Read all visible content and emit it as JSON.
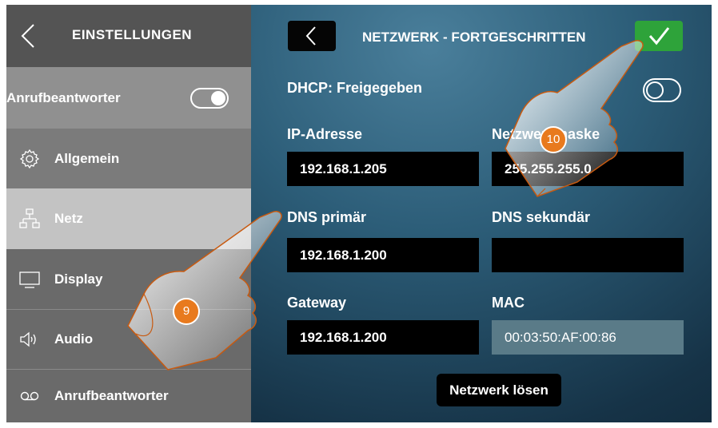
{
  "sidebar": {
    "title": "EINSTELLUNGEN",
    "answering_toggle_label": "Anrufbeantworter",
    "items": [
      {
        "label": "Allgemein",
        "icon": "gear-icon"
      },
      {
        "label": "Netz",
        "icon": "network-icon"
      },
      {
        "label": "Display",
        "icon": "monitor-icon"
      },
      {
        "label": "Audio",
        "icon": "speaker-icon"
      },
      {
        "label": "Anrufbeantworter",
        "icon": "voicemail-icon"
      }
    ]
  },
  "main": {
    "title": "NETZWERK - FORTGESCHRITTEN",
    "dhcp_label": "DHCP: Freigegeben",
    "dhcp_enabled": false,
    "fields": {
      "ip_label": "IP-Adresse",
      "ip_value": "192.168.1.205",
      "mask_label": "Netzwerkmaske",
      "mask_value": "255.255.255.0",
      "dns1_label": "DNS primär",
      "dns1_value": "192.168.1.200",
      "dns2_label": "DNS sekundär",
      "dns2_value": "",
      "gateway_label": "Gateway",
      "gateway_value": "192.168.1.200",
      "mac_label": "MAC",
      "mac_value": "00:03:50:AF:00:86"
    },
    "release_button": "Netzwerk lösen"
  },
  "callouts": {
    "one": "9",
    "two": "10"
  },
  "colors": {
    "confirm": "#2ea33a",
    "callout": "#e87a1e",
    "selected_row": "#c3c3c3"
  }
}
